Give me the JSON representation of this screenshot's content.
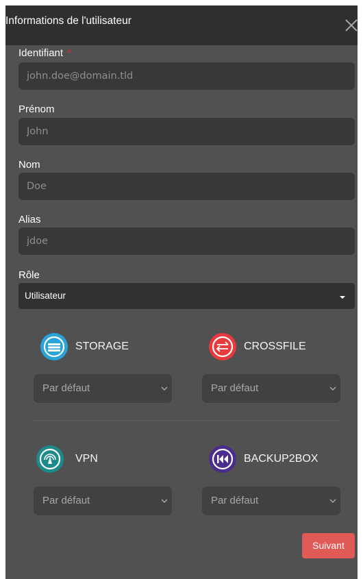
{
  "dialog": {
    "title": "Informations de l'utilisateur"
  },
  "form": {
    "identifiant": {
      "label": "Identifiant",
      "required_mark": "*",
      "placeholder": "john.doe@domain.tld"
    },
    "prenom": {
      "label": "Prénom",
      "placeholder": "John"
    },
    "nom": {
      "label": "Nom",
      "placeholder": "Doe"
    },
    "alias": {
      "label": "Alias",
      "placeholder": "jdoe"
    },
    "role": {
      "label": "Rôle",
      "value": "Utilisateur"
    }
  },
  "services": [
    {
      "name": "STORAGE",
      "icon": "storage-icon",
      "color": "#2aa3d8",
      "value": "Par défaut"
    },
    {
      "name": "CROSSFILE",
      "icon": "crossfile-icon",
      "color": "#e8393d",
      "value": "Par défaut"
    },
    {
      "name": "VPN",
      "icon": "vpn-icon",
      "color": "#1d8a8c",
      "value": "Par défaut"
    },
    {
      "name": "BACKUP2BOX",
      "icon": "backup2box-icon",
      "color": "#4a2d8c",
      "value": "Par défaut"
    }
  ],
  "actions": {
    "next_label": "Suivant"
  },
  "colors": {
    "accent": "#e05a58",
    "header_bg": "#2f2f2f",
    "panel_bg": "#515151",
    "required": "#e02727"
  }
}
